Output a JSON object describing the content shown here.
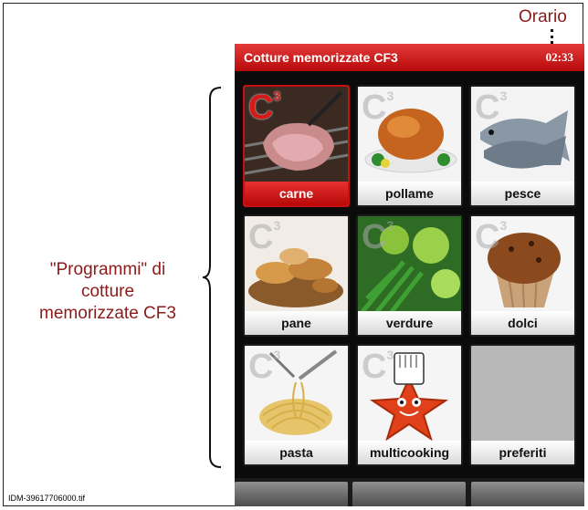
{
  "annotations": {
    "clock_label": "Orario",
    "programs_caption_line1": "\"Programmi\" di",
    "programs_caption_line2": "cotture",
    "programs_caption_line3": "memorizzate CF3",
    "file_id": "IDM-39617706000.tif"
  },
  "screen": {
    "title": "Cotture memorizzate CF3",
    "clock": "02:33",
    "badge": "C3",
    "tiles": [
      {
        "label": "carne",
        "icon": "steak-icon",
        "selected": true
      },
      {
        "label": "pollame",
        "icon": "roast-chicken-icon",
        "selected": false
      },
      {
        "label": "pesce",
        "icon": "fish-icon",
        "selected": false
      },
      {
        "label": "pane",
        "icon": "bread-icon",
        "selected": false
      },
      {
        "label": "verdure",
        "icon": "vegetables-icon",
        "selected": false
      },
      {
        "label": "dolci",
        "icon": "muffin-icon",
        "selected": false
      },
      {
        "label": "pasta",
        "icon": "spaghetti-icon",
        "selected": false
      },
      {
        "label": "multicooking",
        "icon": "chef-star-icon",
        "selected": false
      },
      {
        "label": "preferiti",
        "icon": "",
        "selected": false
      }
    ],
    "accent_color": "#c90f0f"
  }
}
